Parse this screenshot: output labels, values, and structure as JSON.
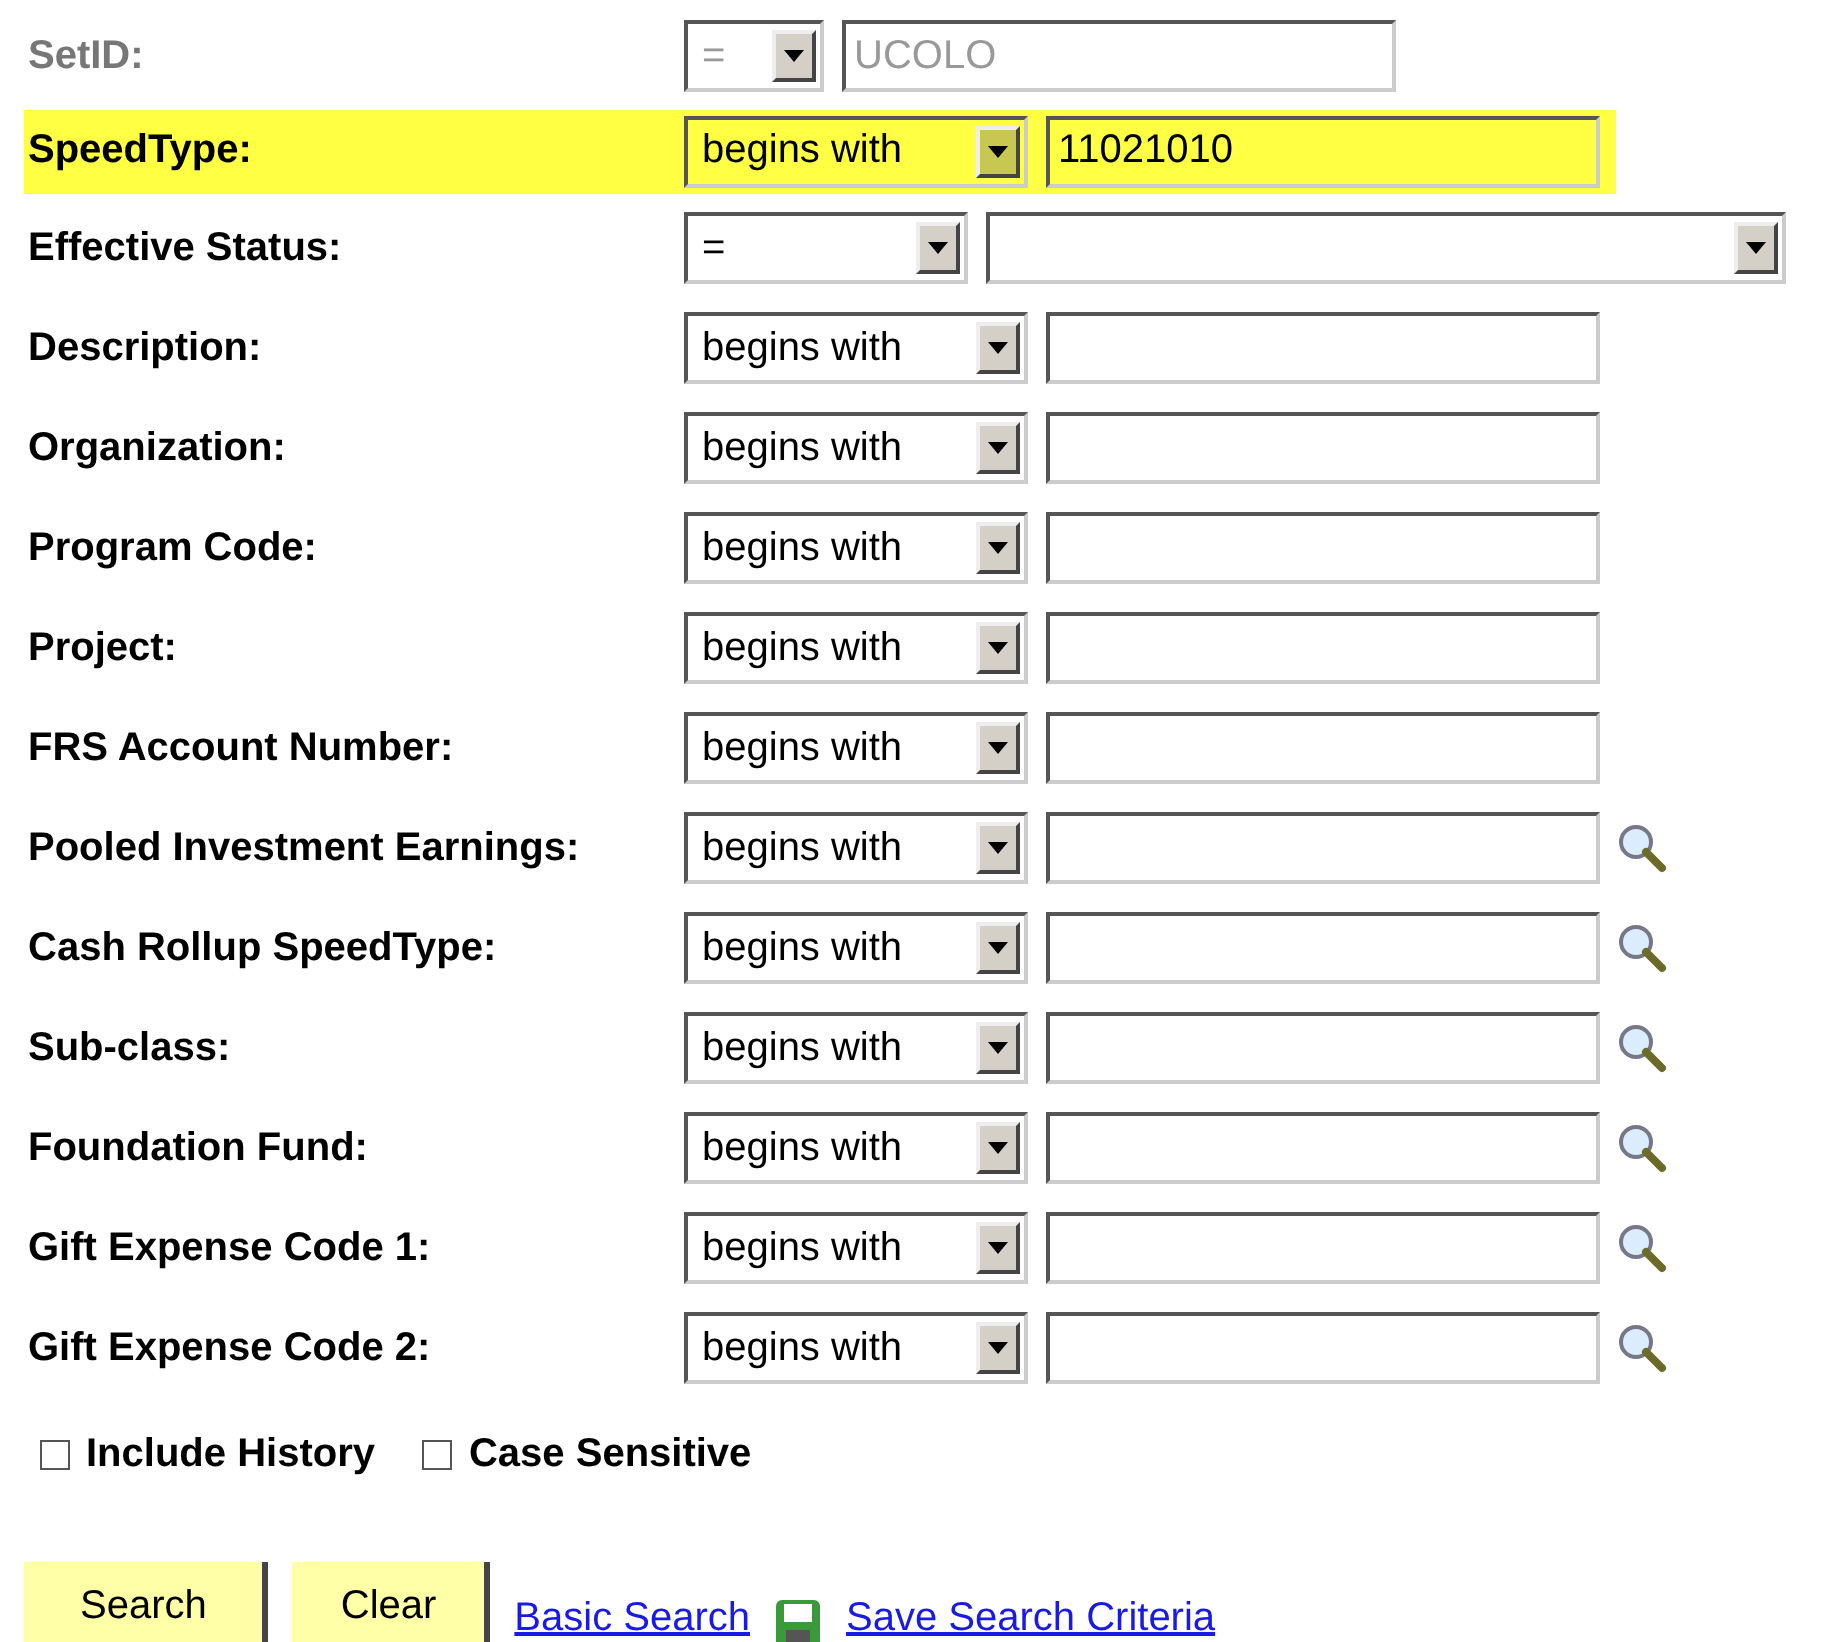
{
  "criteria": [
    {
      "label": "SetID:",
      "operator": "=",
      "value": "UCOLO",
      "kind": "text",
      "disabled": true,
      "highlighted": false,
      "lookup": false
    },
    {
      "label": "SpeedType:",
      "operator": "begins with",
      "value": "11021010",
      "kind": "text",
      "disabled": false,
      "highlighted": true,
      "lookup": false
    },
    {
      "label": "Effective Status:",
      "operator": "=",
      "kind": "select",
      "disabled": false,
      "highlighted": false,
      "lookup": false
    },
    {
      "label": "Description:",
      "operator": "begins with",
      "kind": "text",
      "disabled": false,
      "highlighted": false,
      "lookup": false
    },
    {
      "label": "Organization:",
      "operator": "begins with",
      "kind": "text",
      "disabled": false,
      "highlighted": false,
      "lookup": false
    },
    {
      "label": "Program Code:",
      "operator": "begins with",
      "kind": "text",
      "disabled": false,
      "highlighted": false,
      "lookup": false
    },
    {
      "label": "Project:",
      "operator": "begins with",
      "kind": "text",
      "disabled": false,
      "highlighted": false,
      "lookup": false
    },
    {
      "label": "FRS Account Number:",
      "operator": "begins with",
      "kind": "text",
      "disabled": false,
      "highlighted": false,
      "lookup": false
    },
    {
      "label": "Pooled Investment Earnings:",
      "operator": "begins with",
      "kind": "text",
      "disabled": false,
      "highlighted": false,
      "lookup": true
    },
    {
      "label": "Cash Rollup SpeedType:",
      "operator": "begins with",
      "kind": "text",
      "disabled": false,
      "highlighted": false,
      "lookup": true
    },
    {
      "label": "Sub-class:",
      "operator": "begins with",
      "kind": "text",
      "disabled": false,
      "highlighted": false,
      "lookup": true
    },
    {
      "label": "Foundation Fund:",
      "operator": "begins with",
      "kind": "text",
      "disabled": false,
      "highlighted": false,
      "lookup": true
    },
    {
      "label": "Gift Expense Code 1:",
      "operator": "begins with",
      "kind": "text",
      "disabled": false,
      "highlighted": false,
      "lookup": true
    },
    {
      "label": "Gift Expense Code 2:",
      "operator": "begins with",
      "kind": "text",
      "disabled": false,
      "highlighted": false,
      "lookup": true
    }
  ],
  "options": [
    {
      "label": "Include History",
      "checked": false
    },
    {
      "label": "Case Sensitive",
      "checked": false
    }
  ],
  "buttons": [
    "Search",
    "Clear"
  ],
  "links": [
    {
      "label": "Basic Search",
      "icon": false
    },
    {
      "label": "Save Search Criteria",
      "icon": true
    }
  ]
}
